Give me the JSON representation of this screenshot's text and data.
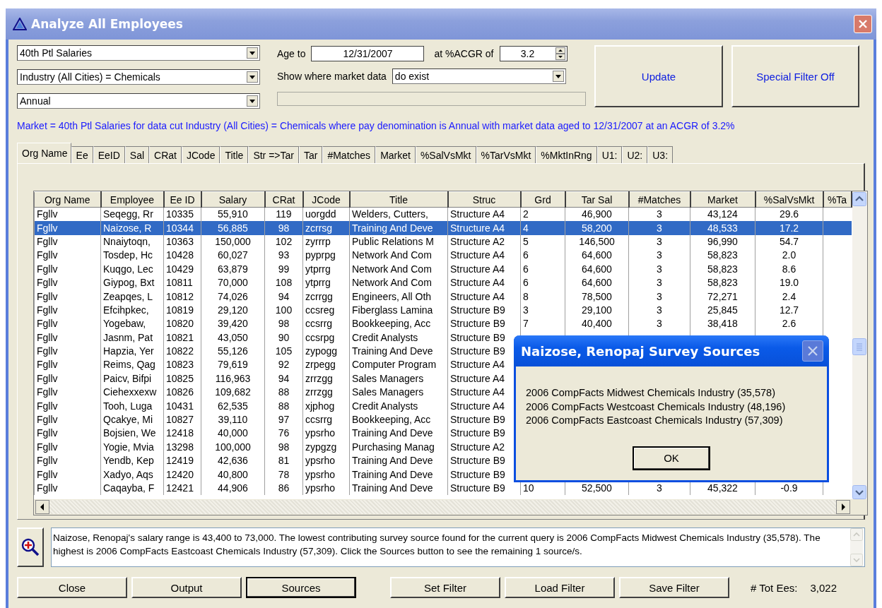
{
  "window": {
    "title": "Analyze All Employees"
  },
  "filters": {
    "measure": "40th Ptl Salaries",
    "data_cut": "Industry (All Cities) = Chemicals",
    "pay_denomination": "Annual",
    "age_to_label": "Age to",
    "age_to": "12/31/2007",
    "acgr_label": "at %ACGR of",
    "acgr": "3.2",
    "market_data_label": "Show where market data",
    "market_data": "do exist",
    "progress": {
      "level": 0
    }
  },
  "action_buttons": [
    "Update",
    "Special Filter Off"
  ],
  "summary": "Market = 40th Ptl Salaries for data cut Industry (All Cities) = Chemicals where pay denomination is Annual with market data aged to 12/31/2007 at an ACGR of 3.2%",
  "tabs": [
    {
      "label": "Org Name",
      "selected": true
    },
    {
      "label": "Ee",
      "selected": false
    },
    {
      "label": "EeID",
      "selected": false
    },
    {
      "label": "Sal",
      "selected": false
    },
    {
      "label": "CRat",
      "selected": false
    },
    {
      "label": "JCode",
      "selected": false
    },
    {
      "label": "Title",
      "selected": false
    },
    {
      "label": "Str =>Tar",
      "selected": false
    },
    {
      "label": "Tar",
      "selected": false
    },
    {
      "label": "#Matches",
      "selected": false
    },
    {
      "label": "Market",
      "selected": false
    },
    {
      "label": "%SalVsMkt",
      "selected": false
    },
    {
      "label": "%TarVsMkt",
      "selected": false
    },
    {
      "label": "%MktInRng",
      "selected": false
    },
    {
      "label": "U1:",
      "selected": false
    },
    {
      "label": "U2:",
      "selected": false
    },
    {
      "label": "U3:",
      "selected": false
    }
  ],
  "table": {
    "columns": [
      "Org Name",
      "Employee",
      "Ee ID",
      "Salary",
      "CRat",
      "JCode",
      "Title",
      "Struc",
      "Grd",
      "Tar Sal",
      "#Matches",
      "Market",
      "%SalVsMkt",
      "%Ta"
    ],
    "rows": [
      {
        "selected": false,
        "cells": [
          "Fgllv",
          "Seqegg, Rr",
          "10335",
          "55,910",
          "119",
          "uorgdd",
          "Welders, Cutters,",
          "Structure A4",
          "2",
          "46,900",
          "3",
          "43,124",
          "29.6"
        ]
      },
      {
        "selected": true,
        "cells": [
          "Fgllv",
          "Naizose, R",
          "10344",
          "56,885",
          "98",
          "zcrrsg",
          "Training And Deve",
          "Structure A4",
          "4",
          "58,200",
          "3",
          "48,533",
          "17.2"
        ]
      },
      {
        "selected": false,
        "cells": [
          "Fgllv",
          "Nnaiytoqn,",
          "10363",
          "150,000",
          "102",
          "zyrrrp",
          "Public Relations M",
          "Structure A2",
          "5",
          "146,500",
          "3",
          "96,990",
          "54.7"
        ]
      },
      {
        "selected": false,
        "cells": [
          "Fgllv",
          "Tosdep, Hc",
          "10428",
          "60,027",
          "93",
          "pyprpg",
          "Network And Com",
          "Structure A4",
          "6",
          "64,600",
          "3",
          "58,823",
          "2.0"
        ]
      },
      {
        "selected": false,
        "cells": [
          "Fgllv",
          "Kuqgo, Lec",
          "10429",
          "63,879",
          "99",
          "ytprrg",
          "Network And Com",
          "Structure A4",
          "6",
          "64,600",
          "3",
          "58,823",
          "8.6"
        ]
      },
      {
        "selected": false,
        "cells": [
          "Fgllv",
          "Giypog, Bxt",
          "10811",
          "70,000",
          "108",
          "ytprrg",
          "Network And Com",
          "Structure A4",
          "6",
          "64,600",
          "3",
          "58,823",
          "19.0"
        ]
      },
      {
        "selected": false,
        "cells": [
          "Fgllv",
          "Zeapqes, L",
          "10812",
          "74,026",
          "94",
          "zcrrgg",
          "Engineers, All Oth",
          "Structure A4",
          "8",
          "78,500",
          "3",
          "72,271",
          "2.4"
        ]
      },
      {
        "selected": false,
        "cells": [
          "Fgllv",
          "Efcihpkec,",
          "10819",
          "29,120",
          "100",
          "ccsreg",
          "Fiberglass Lamina",
          "Structure B9",
          "3",
          "29,100",
          "3",
          "25,845",
          "12.7"
        ]
      },
      {
        "selected": false,
        "cells": [
          "Fgllv",
          "Yogebaw,",
          "10820",
          "39,420",
          "98",
          "ccsrrg",
          "Bookkeeping, Acc",
          "Structure B9",
          "7",
          "40,400",
          "3",
          "38,418",
          "2.6"
        ]
      },
      {
        "selected": false,
        "cells": [
          "Fgllv",
          "Jasnm, Pat",
          "10821",
          "43,050",
          "90",
          "ccsrpg",
          "Credit Analysts",
          "Structure B9"
        ]
      },
      {
        "selected": false,
        "cells": [
          "Fgllv",
          "Hapzia, Yer",
          "10822",
          "55,126",
          "105",
          "zypogg",
          "Training And Deve",
          "Structure B9"
        ]
      },
      {
        "selected": false,
        "cells": [
          "Fgllv",
          "Reims, Qag",
          "10823",
          "79,619",
          "92",
          "zrpegg",
          "Computer Program",
          "Structure A4"
        ]
      },
      {
        "selected": false,
        "cells": [
          "Fgllv",
          "Paicv, Bifpi",
          "10825",
          "116,963",
          "94",
          "zrrzgg",
          "Sales Managers",
          "Structure A4"
        ]
      },
      {
        "selected": false,
        "cells": [
          "Fgllv",
          "Ciehexxexw",
          "10826",
          "109,682",
          "88",
          "zrrzgg",
          "Sales Managers",
          "Structure A4"
        ]
      },
      {
        "selected": false,
        "cells": [
          "Fgllv",
          "Tooh, Luga",
          "10431",
          "62,535",
          "88",
          "xjphog",
          "Credit Analysts",
          "Structure A4"
        ]
      },
      {
        "selected": false,
        "cells": [
          "Fgllv",
          "Qcakye, Mi",
          "10827",
          "39,110",
          "97",
          "ccsrrg",
          "Bookkeeping, Acc",
          "Structure B9"
        ]
      },
      {
        "selected": false,
        "cells": [
          "Fgllv",
          "Bojsien, We",
          "12418",
          "40,000",
          "76",
          "ypsrho",
          "Training And Deve",
          "Structure B9"
        ]
      },
      {
        "selected": false,
        "cells": [
          "Fgllv",
          "Yogie, Mvia",
          "13298",
          "100,000",
          "98",
          "zypgzg",
          "Purchasing Manag",
          "Structure A2"
        ]
      },
      {
        "selected": false,
        "cells": [
          "Fgllv",
          "Yendb, Kep",
          "12419",
          "42,636",
          "81",
          "ypsrho",
          "Training And Deve",
          "Structure B9"
        ]
      },
      {
        "selected": false,
        "cells": [
          "Fgllv",
          "Xadyo, Aqs",
          "12420",
          "40,800",
          "78",
          "ypsrho",
          "Training And Deve",
          "Structure B9"
        ]
      },
      {
        "selected": false,
        "cells": [
          "Fgllv",
          "Caqayba, F",
          "12421",
          "44,906",
          "86",
          "ypsrho",
          "Training And Deve",
          "Structure B9",
          "10",
          "52,500",
          "3",
          "45,322",
          "-0.9"
        ]
      }
    ]
  },
  "dialog": {
    "title": "Naizose, Renopaj Survey Sources",
    "lines": [
      "2006 CompFacts Midwest Chemicals Industry (35,578)",
      "2006 CompFacts Westcoast Chemicals Industry (48,196)",
      "2006 CompFacts Eastcoast Chemicals Industry (57,309)"
    ],
    "button": "OK"
  },
  "message": "Naizose, Renopaj's salary range is 43,400 to 73,000. The lowest contributing survey source found for the current query is 2006 CompFacts Midwest Chemicals Industry (35,578). The highest is 2006 CompFacts Eastcoast Chemicals Industry (57,309). Click the Sources button to see the remaining 1 source/s.",
  "buttons": [
    {
      "label": "Close",
      "default": false
    },
    {
      "label": "Output",
      "default": false
    },
    {
      "label": "Sources",
      "default": true
    },
    {
      "label": "Set Filter",
      "default": false
    },
    {
      "label": "Load Filter",
      "default": false
    },
    {
      "label": "Save Filter",
      "default": false
    }
  ],
  "total": {
    "label": "# Tot Ees:",
    "value": "3,022"
  }
}
